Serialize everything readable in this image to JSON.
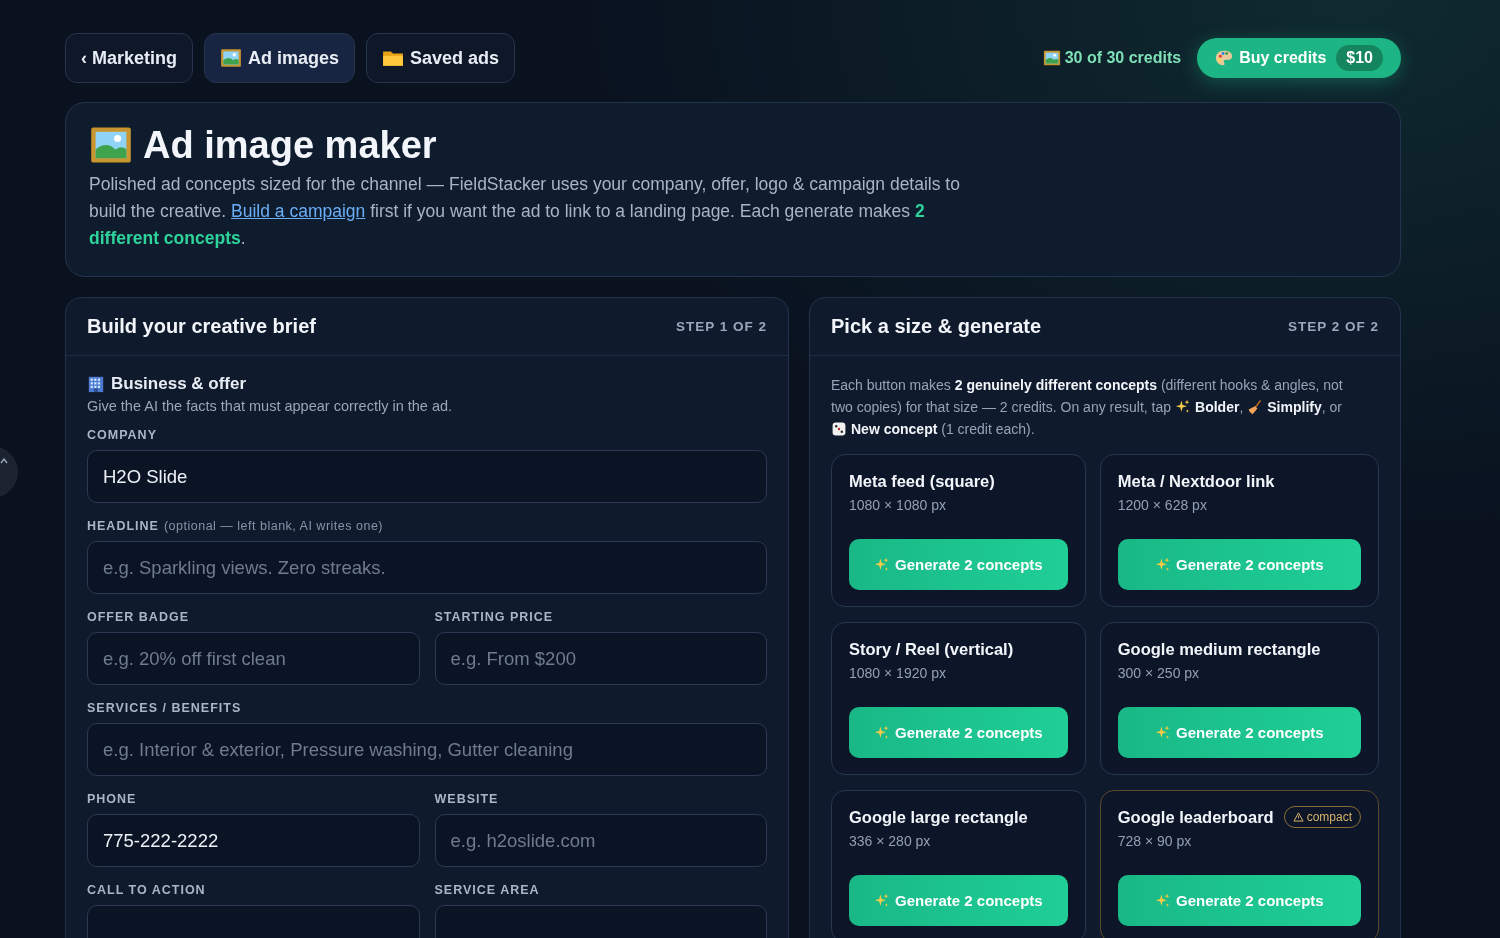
{
  "nav": [
    {
      "label": "‹ Marketing",
      "selected": false
    },
    {
      "label": "Ad images",
      "selected": true
    },
    {
      "label": "Saved ads",
      "selected": false
    }
  ],
  "credits": {
    "label": "30 of 30 credits",
    "button": "Buy credits",
    "price": "$10"
  },
  "hero": {
    "title": "Ad image maker",
    "text_before": "Polished ad concepts sized for the channel — FieldStacker uses your company, offer, logo & campaign details to build the creative.",
    "link": "Build a campaign",
    "text_after": "first if you want the ad to link to a landing page. Each generate makes **2 different concepts**."
  },
  "brief": {
    "title": "Build your creative brief",
    "step": "STEP 1 OF 2",
    "section_title": "Business & offer",
    "section_hint": "Give the AI the facts that must appear correctly in the ad.",
    "rows": [
      [
        {
          "label": "COMPANY",
          "value": "H2O Slide"
        }
      ],
      [
        {
          "label": "HEADLINE",
          "note": "(optional — left blank, AI writes one)",
          "placeholder": "e.g. Sparkling views. Zero streaks."
        }
      ],
      [
        {
          "label": "OFFER BADGE",
          "placeholder": "e.g. 20% off first clean"
        },
        {
          "label": "STARTING PRICE",
          "placeholder": "e.g. From $200"
        }
      ],
      [
        {
          "label": "SERVICES / BENEFITS",
          "placeholder": "e.g. Interior & exterior, Pressure washing, Gutter cleaning"
        }
      ],
      [
        {
          "label": "PHONE",
          "value": "775-222-2222"
        },
        {
          "label": "WEBSITE",
          "placeholder": "e.g. h2oslide.com"
        }
      ],
      [
        {
          "label": "CALL TO ACTION"
        },
        {
          "label": "SERVICE AREA"
        }
      ]
    ]
  },
  "generate": {
    "title": "Pick a size & generate",
    "step": "STEP 2 OF 2",
    "info": {
      "line_1": "Each button makes **2 genuinely different concepts** (different hooks & angles, not",
      "line_2": "two copies) for that size — 2 credits. On any result, tap",
      "bolder": "**Bolder**,",
      "simplify": "**Simplify**, or",
      "new_concept": "**New concept** (1 credit each)."
    },
    "sizes": [
      {
        "name": "Meta feed (square)",
        "dims": "1080 × 1080 px",
        "button": "Generate 2 concepts"
      },
      {
        "name": "Meta / Nextdoor link",
        "dims": "1200 × 628 px",
        "button": "Generate 2 concepts"
      },
      {
        "name": "Story / Reel (vertical)",
        "dims": "1080 × 1920 px",
        "button": "Generate 2 concepts"
      },
      {
        "name": "Google medium rectangle",
        "dims": "300 × 250 px",
        "button": "Generate 2 concepts"
      },
      {
        "name": "Google large rectangle",
        "dims": "336 × 280 px",
        "button": "Generate 2 concepts"
      },
      {
        "name": "Google leaderboard",
        "dims": "728 × 90 px",
        "button": "Generate 2 concepts",
        "badge": "compact"
      }
    ]
  }
}
